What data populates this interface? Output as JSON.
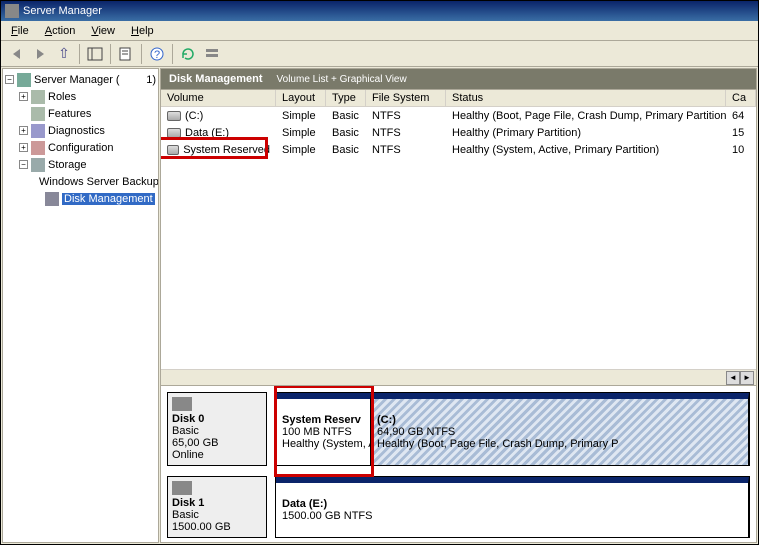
{
  "window": {
    "title": "Server Manager"
  },
  "menu": {
    "file": "File",
    "action": "Action",
    "view": "View",
    "help": "Help"
  },
  "tree": {
    "root": {
      "label": "Server Manager (",
      "count": "1)"
    },
    "roles": "Roles",
    "features": "Features",
    "diagnostics": "Diagnostics",
    "configuration": "Configuration",
    "storage": "Storage",
    "wsb": "Windows Server Backup",
    "diskmgmt": "Disk Management"
  },
  "header": {
    "title": "Disk Management",
    "sub": "Volume List + Graphical View"
  },
  "cols": {
    "volume": "Volume",
    "layout": "Layout",
    "type": "Type",
    "fs": "File System",
    "status": "Status",
    "cap": "Ca"
  },
  "volumes": [
    {
      "name": "(C:)",
      "layout": "Simple",
      "type": "Basic",
      "fs": "NTFS",
      "status": "Healthy (Boot, Page File, Crash Dump, Primary Partition)",
      "cap": "64"
    },
    {
      "name": "Data (E:)",
      "layout": "Simple",
      "type": "Basic",
      "fs": "NTFS",
      "status": "Healthy (Primary Partition)",
      "cap": "15"
    },
    {
      "name": "System Reserved",
      "layout": "Simple",
      "type": "Basic",
      "fs": "NTFS",
      "status": "Healthy (System, Active, Primary Partition)",
      "cap": "10"
    }
  ],
  "disk0": {
    "label": "Disk 0",
    "type": "Basic",
    "size": "65,00 GB",
    "status": "Online",
    "sysres": {
      "title": "System Reserv",
      "line2": "100 MB NTFS",
      "line3": "Healthy (System, A"
    },
    "c": {
      "title": "(C:)",
      "line2": "64,90 GB NTFS",
      "line3": "Healthy (Boot, Page File, Crash Dump, Primary P"
    }
  },
  "disk1": {
    "label": "Disk 1",
    "type": "Basic",
    "size": "1500.00 GB",
    "data": {
      "title": "Data  (E:)",
      "line2": "1500.00 GB NTFS"
    }
  }
}
